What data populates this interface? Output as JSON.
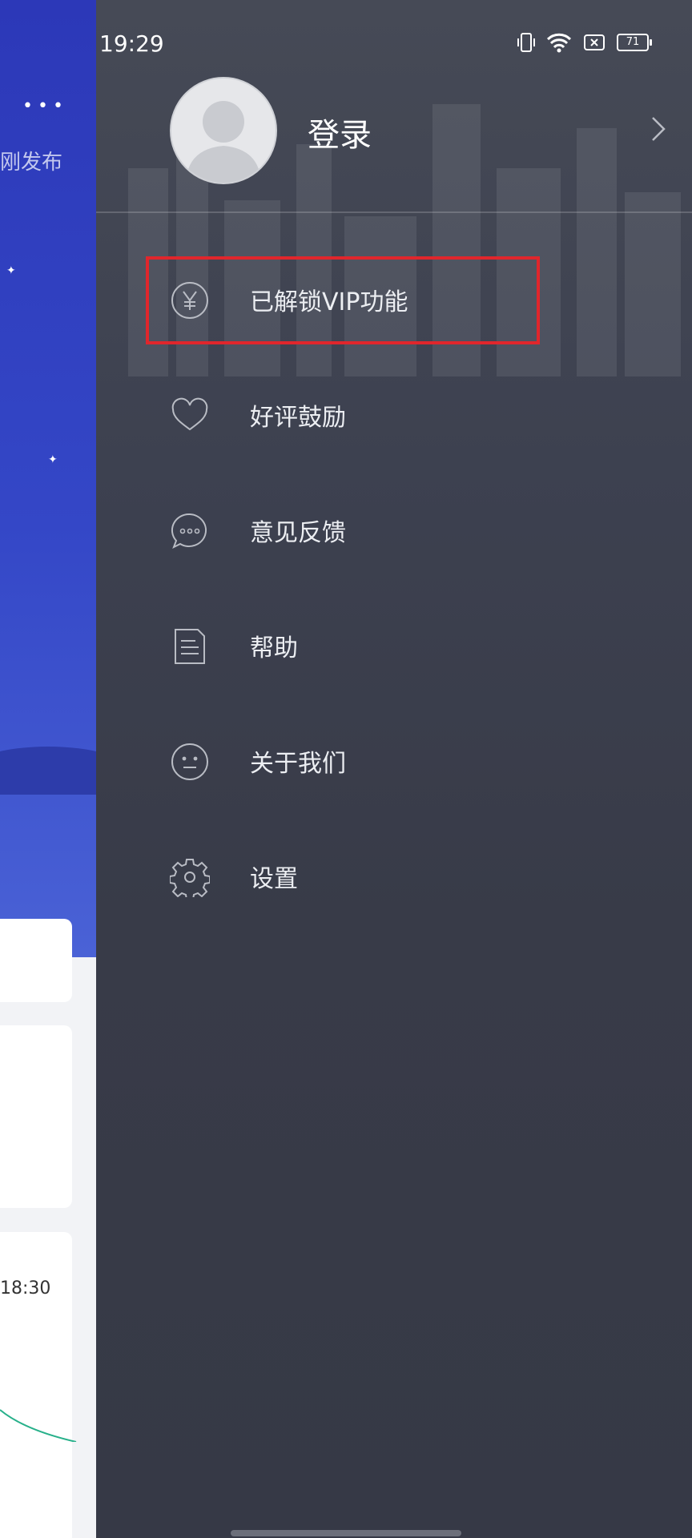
{
  "status_bar": {
    "time": "19:29",
    "battery": "71",
    "icons": [
      "vibrate-icon",
      "wifi-icon",
      "sim-icon",
      "battery-icon"
    ]
  },
  "background_app": {
    "more_label": "•••",
    "publish_text": "刚发布",
    "time_text": "18:30"
  },
  "drawer": {
    "login_label": "登录",
    "menu": [
      {
        "label": "已解锁VIP功能",
        "icon": "yen-icon"
      },
      {
        "label": "好评鼓励",
        "icon": "heart-icon"
      },
      {
        "label": "意见反馈",
        "icon": "chat-icon"
      },
      {
        "label": "帮助",
        "icon": "document-icon"
      },
      {
        "label": "关于我们",
        "icon": "face-icon"
      },
      {
        "label": "设置",
        "icon": "gear-icon"
      }
    ]
  },
  "colors": {
    "drawer_bg": "#3a3e4c",
    "highlight": "#e0262c",
    "hero_blue": "#2c38b8"
  }
}
